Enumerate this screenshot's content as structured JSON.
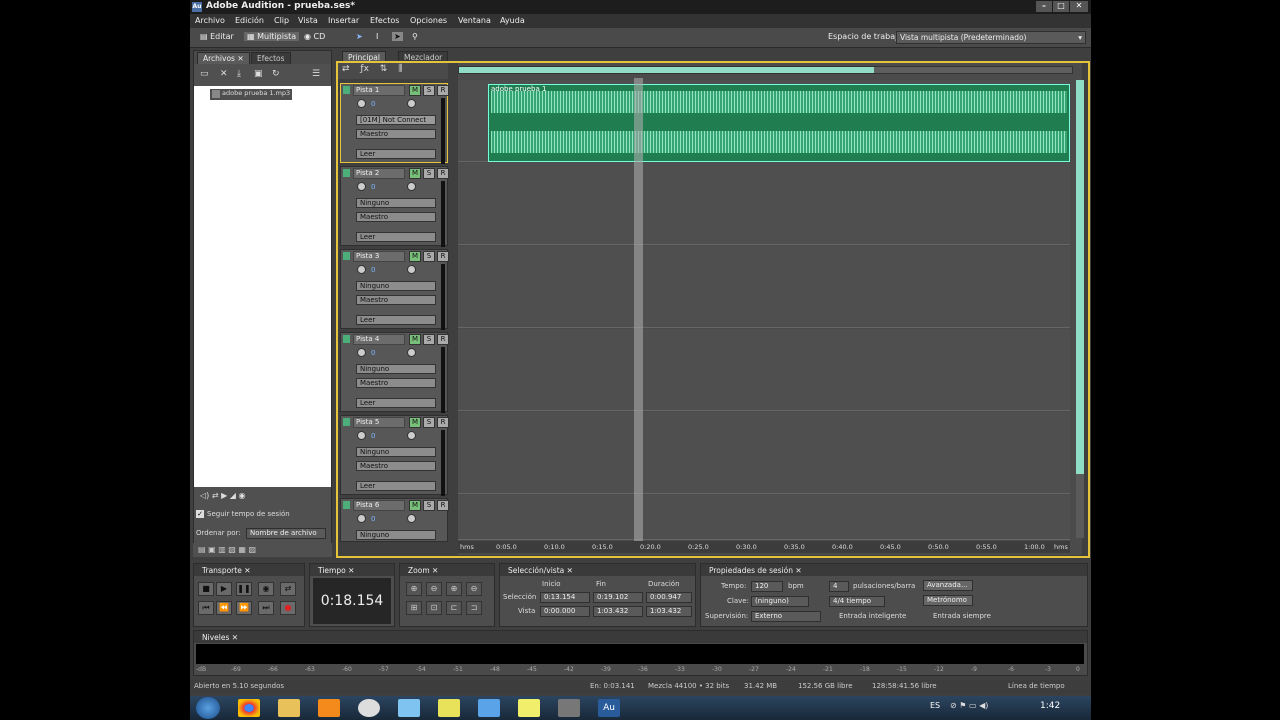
{
  "window": {
    "title": "Adobe Audition - prueba.ses*"
  },
  "menu": [
    "Archivo",
    "Edición",
    "Clip",
    "Vista",
    "Insertar",
    "Efectos",
    "Opciones",
    "Ventana",
    "Ayuda"
  ],
  "toolbar": {
    "editar": "Editar",
    "multipista": "Multipista",
    "cd": "CD",
    "workspace_label": "Espacio de trabajo",
    "workspace_value": "Vista multipista (Predeterminado)"
  },
  "left_panel": {
    "tabs": [
      "Archivos",
      "Efectos"
    ],
    "file_item": "adobe prueba 1.mp3",
    "follow_tempo": "Seguir tempo de sesión",
    "sort_label": "Ordenar por:",
    "sort_value": "Nombre de archivo"
  },
  "main_tabs": [
    "Principal",
    "Mezclador"
  ],
  "tracks": [
    {
      "name": "Pista 1",
      "vol": "0",
      "input": "[01M] Not Connect",
      "output": "Maestro",
      "mode": "Leer"
    },
    {
      "name": "Pista 2",
      "vol": "0",
      "input": "Ninguno",
      "output": "Maestro",
      "mode": "Leer"
    },
    {
      "name": "Pista 3",
      "vol": "0",
      "input": "Ninguno",
      "output": "Maestro",
      "mode": "Leer"
    },
    {
      "name": "Pista 4",
      "vol": "0",
      "input": "Ninguno",
      "output": "Maestro",
      "mode": "Leer"
    },
    {
      "name": "Pista 5",
      "vol": "0",
      "input": "Ninguno",
      "output": "Maestro",
      "mode": "Leer"
    },
    {
      "name": "Pista 6",
      "vol": "0",
      "input": "Ninguno",
      "output": "",
      "mode": ""
    }
  ],
  "msr": [
    "M",
    "S",
    "R"
  ],
  "clip_name": "adobe prueba 1",
  "ruler": [
    "hms",
    "0:05.0",
    "0:10.0",
    "0:15.0",
    "0:20.0",
    "0:25.0",
    "0:30.0",
    "0:35.0",
    "0:40.0",
    "0:45.0",
    "0:50.0",
    "0:55.0",
    "1:00.0",
    "hms"
  ],
  "transport": {
    "title": "Transporte"
  },
  "time": {
    "title": "Tiempo",
    "value": "0:18.154"
  },
  "zoom": {
    "title": "Zoom"
  },
  "selection": {
    "title": "Selección/vista",
    "headers": [
      "Inicio",
      "Fin",
      "Duración"
    ],
    "rows": [
      {
        "label": "Selección",
        "values": [
          "0:13.154",
          "0:19.102",
          "0:00.947"
        ]
      },
      {
        "label": "Vista",
        "values": [
          "0:00.000",
          "1:03.432",
          "1:03.432"
        ]
      }
    ]
  },
  "session": {
    "title": "Propiedades de sesión",
    "tempo_label": "Tempo:",
    "tempo_value": "120",
    "bpm": "bpm",
    "beats_value": "4",
    "beats_label": "pulsaciones/barra",
    "advanced": "Avanzada...",
    "key_label": "Clave:",
    "key_value": "(ninguno)",
    "time_sig": "4/4 tiempo",
    "metronome": "Metrónomo",
    "supervision_label": "Supervisión:",
    "supervision_value": "Externo",
    "smart_input": "Entrada inteligente",
    "always_input": "Entrada siempre"
  },
  "levels": {
    "title": "Niveles",
    "ticks": [
      "-dB",
      "-69",
      "-66",
      "-63",
      "-60",
      "-57",
      "-54",
      "-51",
      "-48",
      "-45",
      "-42",
      "-39",
      "-36",
      "-33",
      "-30",
      "-27",
      "-24",
      "-21",
      "-18",
      "-15",
      "-12",
      "-9",
      "-6",
      "-3",
      "0"
    ]
  },
  "status": {
    "opened": "Abierto en 5.10 segundos",
    "at": "En: 0:03.141",
    "mix": "Mezcla 44100 • 32 bits",
    "size": "31.42 MB",
    "free": "152.56 GB libre",
    "time_free": "128:58:41.56 libre",
    "timeline": "Línea de tiempo"
  },
  "taskbar": {
    "lang": "ES",
    "clock": "1:42"
  }
}
